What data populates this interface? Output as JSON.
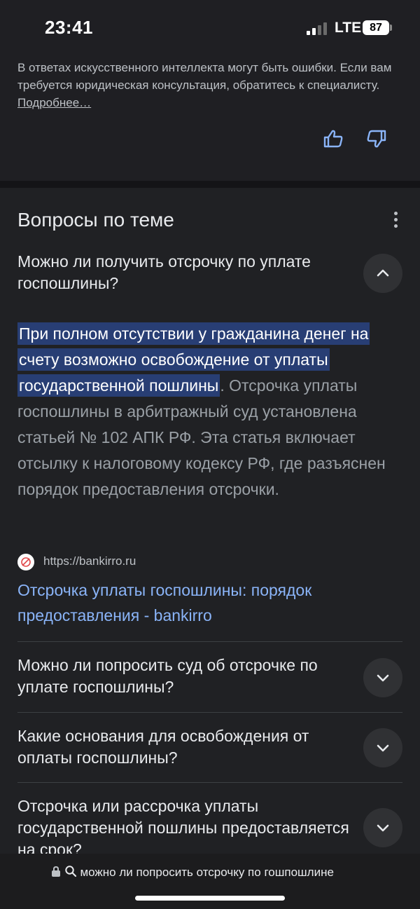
{
  "status_bar": {
    "time": "23:41",
    "network": "LTE",
    "battery": "87"
  },
  "disclaimer": {
    "text": "В ответах искусственного интеллекта могут быть ошибки. Если вам требуется юридическая консультация, обратитесь к специалисту. ",
    "link": "Подробнее…"
  },
  "related": {
    "title": "Вопросы по теме",
    "expanded": {
      "question": "Можно ли получить отсрочку по уплате госпошлины?",
      "answer_highlight": "При полном отсутствии у гражданина денег на счету возможно освобождение от уплаты государственной пошлины",
      "answer_rest": ". Отсрочка уплаты госпошлины в арбитражный суд установлена статьей № 102 АПК РФ. Эта статья включает отсылку к налоговому кодексу РФ, где разъяснен порядок предоставления отсрочки.",
      "source_url": "https://bankirro.ru",
      "source_title": "Отсрочка уплаты госпошлины: порядок предоставления - bankirro"
    },
    "collapsed": [
      {
        "question": "Можно ли попросить суд об отсрочке по уплате госпошлины?"
      },
      {
        "question": "Какие основания для освобождения от оплаты госпошлины?"
      },
      {
        "question": "Отсрочка или рассрочка уплаты государственной пошлины предоставляется на срок?"
      }
    ]
  },
  "address_bar": {
    "query": "можно ли попросить отсрочку по гошпошлине"
  },
  "colors": {
    "background": "#202124",
    "link": "#8ab4f8",
    "highlight": "#283e74"
  },
  "icons": [
    "lock-icon",
    "search-icon",
    "thumbs-up-icon",
    "thumbs-down-icon",
    "more-vert-icon",
    "chevron-up-icon",
    "chevron-down-icon"
  ]
}
